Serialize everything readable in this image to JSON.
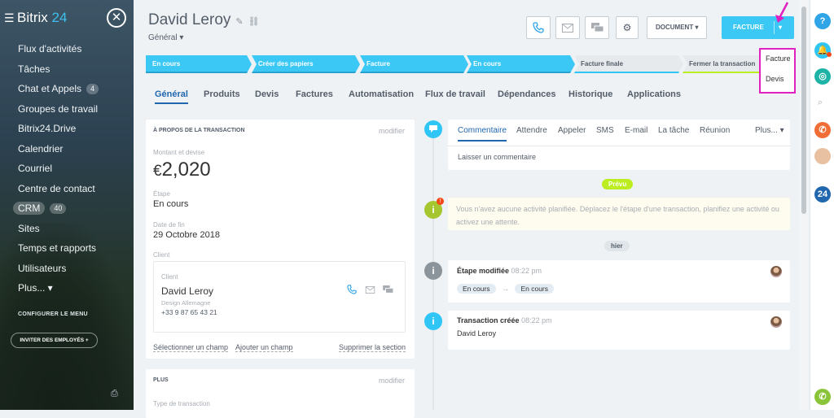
{
  "sidebar": {
    "logo_name": "Bitrix",
    "logo_num": "24",
    "items": [
      {
        "label": "Flux d'activités"
      },
      {
        "label": "Tâches"
      },
      {
        "label": "Chat et Appels",
        "count": "4"
      },
      {
        "label": "Groupes de travail"
      },
      {
        "label": "Bitrix24.Drive"
      },
      {
        "label": "Calendrier"
      },
      {
        "label": "Courriel"
      },
      {
        "label": "Centre de contact"
      },
      {
        "label": "CRM",
        "count": "40"
      },
      {
        "label": "Sites"
      },
      {
        "label": "Temps et rapports"
      },
      {
        "label": "Utilisateurs"
      },
      {
        "label": "Plus... ▾"
      }
    ],
    "configure_menu": "CONFIGURER LE MENU",
    "invite": "INVITER DES EMPLOYÉS +"
  },
  "header": {
    "title": "David Leroy",
    "subtitle": "Général ▾",
    "document_btn": "DOCUMENT ▾",
    "facture_btn": "FACTURE",
    "facture_arrow": "▾"
  },
  "dropdown": {
    "items": [
      "Facture",
      "Devis"
    ]
  },
  "stages": [
    "En cours",
    "Créer des papiers",
    "Facture",
    "En cours",
    "Facture finale",
    "Fermer la transaction"
  ],
  "tabs": [
    "Général",
    "Produits",
    "Devis",
    "Factures",
    "Automatisation",
    "Flux de travail",
    "Dépendances",
    "Historique",
    "Applications"
  ],
  "about": {
    "header": "À PROPOS DE LA TRANSACTION",
    "modify": "modifier",
    "amount_label": "Montant et devise",
    "currency": "€",
    "amount": "2,020",
    "stage_label": "Étape",
    "stage_value": "En cours",
    "end_label": "Date de fin",
    "end_value": "29 Octobre 2018",
    "client_label": "Client",
    "client_inner_label": "Client",
    "client_name": "David Leroy",
    "client_company": "Design Allemagne",
    "client_phone": "+33 9 87 65 43 21",
    "select_field": "Sélectionner un champ",
    "add_field": "Ajouter un champ",
    "delete_section": "Supprimer la section"
  },
  "plus_card": {
    "header": "PLUS",
    "modify": "modifier",
    "type_label": "Type de transaction"
  },
  "activity": {
    "tabs": [
      "Commentaire",
      "Attendre",
      "Appeler",
      "SMS",
      "E-mail",
      "La tâche",
      "Réunion"
    ],
    "more": "Plus... ▾",
    "comment_placeholder": "Laisser un commentaire",
    "planned_pill": "Prévu",
    "planned_text": "Vous n'avez aucune activité planifiée. Déplacez le l'étape d'une transaction, planifiez une activité ou activez une attente.",
    "yesterday_pill": "hier",
    "entry1_title": "Étape modifiée",
    "entry1_time": "08:22 pm",
    "entry1_from": "En cours",
    "entry1_arrow": "→",
    "entry1_to": "En cours",
    "entry2_title": "Transaction créée",
    "entry2_time": "08:22 pm",
    "entry2_text": "David Leroy"
  },
  "right_panel": {
    "help": "?",
    "badge_24": "24"
  },
  "colors": {
    "accent": "#3bc8f5",
    "highlight": "#e020c0",
    "link": "#2067b0"
  }
}
